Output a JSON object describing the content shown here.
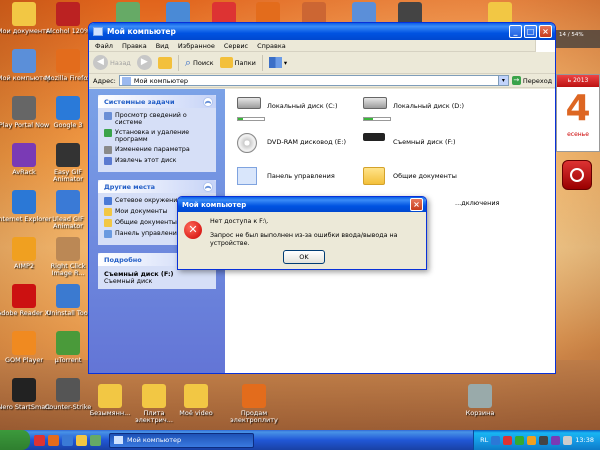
{
  "desktop": {
    "left_icons": [
      {
        "label": "Мои документы",
        "color": "#f2c744"
      },
      {
        "label": "Alcohol 120%",
        "color": "#b22"
      },
      {
        "label": "Мой компьютер",
        "color": "#5b8fd9"
      },
      {
        "label": "Mozilla Firefox",
        "color": "#e36c1c"
      },
      {
        "label": "Play Portal Now",
        "color": "#666"
      },
      {
        "label": "Google 3",
        "color": "#2a7ad9"
      },
      {
        "label": "AvRack",
        "color": "#7a3ab5"
      },
      {
        "label": "Easy GIF Animator",
        "color": "#333"
      },
      {
        "label": "Internet Explorer",
        "color": "#2b78d6"
      },
      {
        "label": "Ulead GIF Animator",
        "color": "#3a7ad6"
      },
      {
        "label": "AIMP2",
        "color": "#f0a020"
      },
      {
        "label": "Right Click Image R...",
        "color": "#b85"
      },
      {
        "label": "Adobe Reader XI",
        "color": "#c11"
      },
      {
        "label": "Uninstall Tool",
        "color": "#3b7ad0"
      },
      {
        "label": "GOM Player",
        "color": "#f08a20"
      },
      {
        "label": "µTorrent",
        "color": "#4a9a3a"
      },
      {
        "label": "Nero StartSmart",
        "color": "#222"
      },
      {
        "label": "Counter-Strike",
        "color": "#555"
      }
    ],
    "bottom_icons": [
      {
        "label": "Безымянн...",
        "color": "#f2c744"
      },
      {
        "label": "Плита электрич...",
        "color": "#f2c744"
      },
      {
        "label": "Моё video",
        "color": "#f2c744"
      },
      {
        "label": "Продам электроплиту",
        "color": "#e36c1c"
      },
      {
        "label": "Корзина",
        "color": "#9aa"
      }
    ],
    "top_icons_colors": [
      "#6a6",
      "#4a8ad6",
      "#d33",
      "#e36c1c",
      "#c63",
      "#5b8fd9",
      "#444",
      "#f2c744"
    ],
    "widget_text": "14 / 54%",
    "calendar": {
      "month": "ь 2013",
      "day": "4",
      "weekday": "есенье"
    }
  },
  "window": {
    "title": "Мой компьютер",
    "menu": [
      "Файл",
      "Правка",
      "Вид",
      "Избранное",
      "Сервис",
      "Справка"
    ],
    "toolbar": {
      "back": "Назад",
      "search": "Поиск",
      "folders": "Папки"
    },
    "address_label": "Адрес:",
    "address_value": "Мой компьютер",
    "go_label": "Переход",
    "panels": {
      "system_tasks": {
        "title": "Системные задачи",
        "items": [
          "Просмотр сведений о системе",
          "Установка и удаление программ",
          "Изменение параметра",
          "Извлечь этот диск"
        ]
      },
      "other_places": {
        "title": "Другие места",
        "items": [
          "Сетевое окружение",
          "Мои документы",
          "Общие документы",
          "Панель управления"
        ]
      },
      "details": {
        "title": "Подробно",
        "name": "Съемный диск (F:)",
        "type": "Съемный диск"
      }
    },
    "items": [
      {
        "label": "Локальный диск (C:)",
        "kind": "drive",
        "usage": 0.2
      },
      {
        "label": "Локальный диск (D:)",
        "kind": "drive",
        "usage": 0.35
      },
      {
        "label": "DVD-RAM дисковод (E:)",
        "kind": "dvd"
      },
      {
        "label": "Съемный диск (F:)",
        "kind": "usb"
      },
      {
        "label": "Панель управления",
        "kind": "cp"
      },
      {
        "label": "Общие документы",
        "kind": "folder"
      },
      {
        "label": "...дключения",
        "kind": "partial"
      }
    ]
  },
  "dialog": {
    "title": "Мой компьютер",
    "line1": "Нет доступа к F:\\.",
    "line2": "Запрос не был выполнен из-за ошибки ввода/вывода на устройстве.",
    "ok": "OK"
  },
  "taskbar": {
    "task_label": "Мой компьютер",
    "lang": "RL",
    "clock": "13:38",
    "ql_colors": [
      "#d33",
      "#e36c1c",
      "#3a7ad6",
      "#f2c744",
      "#6a6"
    ],
    "tray_colors": [
      "#2b78d6",
      "#d33",
      "#3a3",
      "#f0a020",
      "#444",
      "#7a3ab5",
      "#ccc"
    ]
  }
}
